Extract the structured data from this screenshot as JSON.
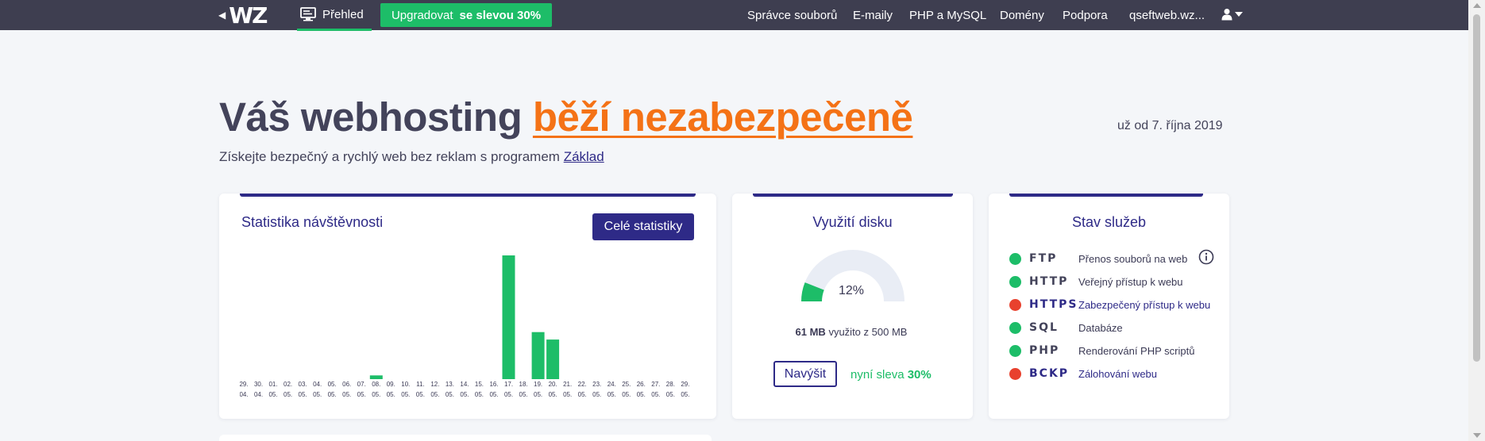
{
  "colors": {
    "topbar": "#3e3e50",
    "brand_green": "#1dbd68",
    "brand_purple": "#2e2a87",
    "warning_orange": "#f47216",
    "status_ok": "#1dbd68",
    "status_error": "#e8412e",
    "bar": "#1dbd68"
  },
  "topbar": {
    "logo_text": "WZ",
    "logo_back_icon": "chevron-left-icon",
    "overview_icon": "monitor-icon",
    "overview_label": "Přehled",
    "upgrade_label": "Upgradovat",
    "upgrade_strong": "se slevou 30%",
    "nav": [
      "Správce souborů",
      "E-maily",
      "PHP a MySQL",
      "Domény",
      "Podpora",
      "qseftweb.wz..."
    ],
    "user_icon": "user-icon",
    "caret_icon": "caret-down-icon"
  },
  "hero": {
    "title_prefix": "Váš webhosting",
    "title_warning": "běží nezabezpečeně",
    "since": "už od 7. října 2019",
    "subtitle_prefix": "Získejte bezpečný a rychlý web bez reklam s programem",
    "subtitle_link": "Základ"
  },
  "traffic": {
    "title": "Statistika návštěvnosti",
    "button_label": "Celé statistiky"
  },
  "chart_data": {
    "type": "bar",
    "title": "Statistika návštěvnosti",
    "xlabel": "",
    "ylabel": "",
    "categories": [
      "29. 04.",
      "30. 04.",
      "01. 05.",
      "02. 05.",
      "03. 05.",
      "04. 05.",
      "05. 05.",
      "06. 05.",
      "07. 05.",
      "08. 05.",
      "09. 05.",
      "10. 05.",
      "11. 05.",
      "12. 05.",
      "13. 05.",
      "14. 05.",
      "15. 05.",
      "16. 05.",
      "17. 05.",
      "18. 05.",
      "19. 05.",
      "20. 05.",
      "21. 05.",
      "22. 05.",
      "23. 05.",
      "24. 05.",
      "25. 05.",
      "26. 05.",
      "27. 05.",
      "28. 05.",
      "29. 05."
    ],
    "values": [
      0,
      0,
      0,
      0,
      0,
      0,
      0,
      0,
      0,
      3,
      0,
      0,
      0,
      0,
      0,
      0,
      0,
      0,
      100,
      0,
      38,
      32,
      0,
      0,
      0,
      0,
      0,
      0,
      0,
      0,
      0
    ],
    "ylim": [
      0,
      100
    ],
    "grid": false,
    "legend": "none"
  },
  "disk": {
    "title": "Využití disku",
    "percent": 12,
    "percent_label": "12%",
    "used": "61 MB",
    "usage_text": "využito z 500 MB",
    "button_label": "Navýšit",
    "discount_prefix": "nyní sleva",
    "discount_value": "30%"
  },
  "services": {
    "title": "Stav služeb",
    "info_icon": "info-icon",
    "items": [
      {
        "code": "FTP",
        "label": "Přenos souborů na web",
        "status": "ok"
      },
      {
        "code": "HTTP",
        "label": "Veřejný přístup k webu",
        "status": "ok"
      },
      {
        "code": "HTTPS",
        "label": "Zabezpečený přístup k webu",
        "status": "error"
      },
      {
        "code": "SQL",
        "label": "Databáze",
        "status": "ok"
      },
      {
        "code": "PHP",
        "label": "Renderování PHP scriptů",
        "status": "ok"
      },
      {
        "code": "BCKP",
        "label": "Zálohování webu",
        "status": "error"
      }
    ]
  }
}
